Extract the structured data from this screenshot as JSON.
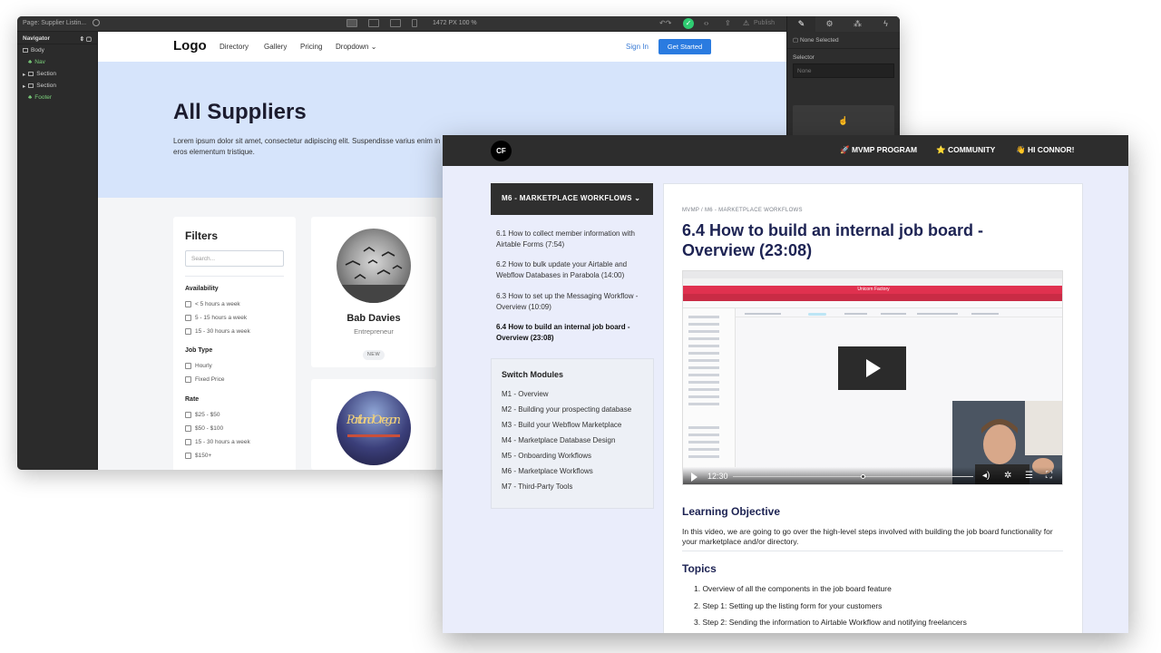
{
  "webflow": {
    "page_label": "Page: Supplier Listin...",
    "canvas_size": "1472 PX  100 %",
    "publish_label": "Publish",
    "navigator": {
      "title": "Navigator",
      "items": [
        {
          "label": "Body",
          "indent": 0,
          "green": false
        },
        {
          "label": "Nav",
          "indent": 1,
          "green": true
        },
        {
          "label": "Section",
          "indent": 0,
          "green": false
        },
        {
          "label": "Section",
          "indent": 0,
          "green": false
        },
        {
          "label": "Footer",
          "indent": 1,
          "green": true
        }
      ]
    },
    "right_panel": {
      "none_selected": "None Selected",
      "selector_label": "Selector",
      "selector_placeholder": "None"
    },
    "site": {
      "logo": "Logo",
      "nav_links": [
        "Directory",
        "Gallery",
        "Pricing",
        "Dropdown ⌄"
      ],
      "sign_in": "Sign In",
      "get_started": "Get Started",
      "hero_title": "All Suppliers",
      "hero_text": "Lorem ipsum dolor sit amet, consectetur adipiscing elit. Suspendisse varius enim in eros elementum tristique.",
      "filters": {
        "title": "Filters",
        "search_placeholder": "Search...",
        "sections": [
          {
            "title": "Availability",
            "options": [
              "< 5 hours a week",
              "5 - 15 hours a week",
              "15 - 30 hours a week"
            ]
          },
          {
            "title": "Job Type",
            "options": [
              "Hourly",
              "Fixed Price"
            ]
          },
          {
            "title": "Rate",
            "options": [
              "$25 - $50",
              "$50 - $100",
              "15 - 30 hours a week",
              "$150+"
            ]
          }
        ]
      },
      "supplier": {
        "name": "Bab Davies",
        "role": "Entrepreneur",
        "badge": "NEW"
      },
      "second_card_sign": "Portland Oregon"
    }
  },
  "course": {
    "logo": "CF",
    "nav": [
      "🚀 MVMP PROGRAM",
      "⭐ COMMUNITY",
      "👋 HI CONNOR!"
    ],
    "module_button": "M6 - MARKETPLACE WORKFLOWS ⌄",
    "lessons": [
      "6.1 How to collect member information with Airtable Forms (7:54)",
      "6.2 How to bulk update your Airtable and Webflow Databases in Parabola (14:00)",
      "6.3 How to set up the Messaging Workflow - Overview (10:09)",
      "6.4 How to build an internal job board - Overview (23:08)"
    ],
    "current_lesson_index": 3,
    "switch_modules": {
      "title": "Switch Modules",
      "items": [
        "M1 - Overview",
        "M2 - Building your prospecting database",
        "M3 - Build your Webflow Marketplace",
        "M4 - Marketplace Database Design",
        "M5 - Onboarding Workflows",
        "M6 - Marketplace Workflows",
        "M7 - Third-Party Tools"
      ]
    },
    "breadcrumb": "MVMP / M6 - MARKETPLACE WORKFLOWS",
    "lesson_title": "6.4 How to build an internal job board - Overview (23:08)",
    "video": {
      "app_title": "Unicorn Factory",
      "time": "12:30",
      "progress": 0.54
    },
    "learning_objective": {
      "title": "Learning Objective",
      "text": "In this video, we are going to go over the high-level steps involved with building the job board functionality for your marketplace and/or directory."
    },
    "topics": {
      "title": "Topics",
      "items": [
        "1. Overview of all the components in the job board feature",
        "2. Step 1: Setting up the listing form for your customers",
        "3. Step 2: Sending the information to Airtable Workflow and notifying freelancers"
      ]
    }
  }
}
